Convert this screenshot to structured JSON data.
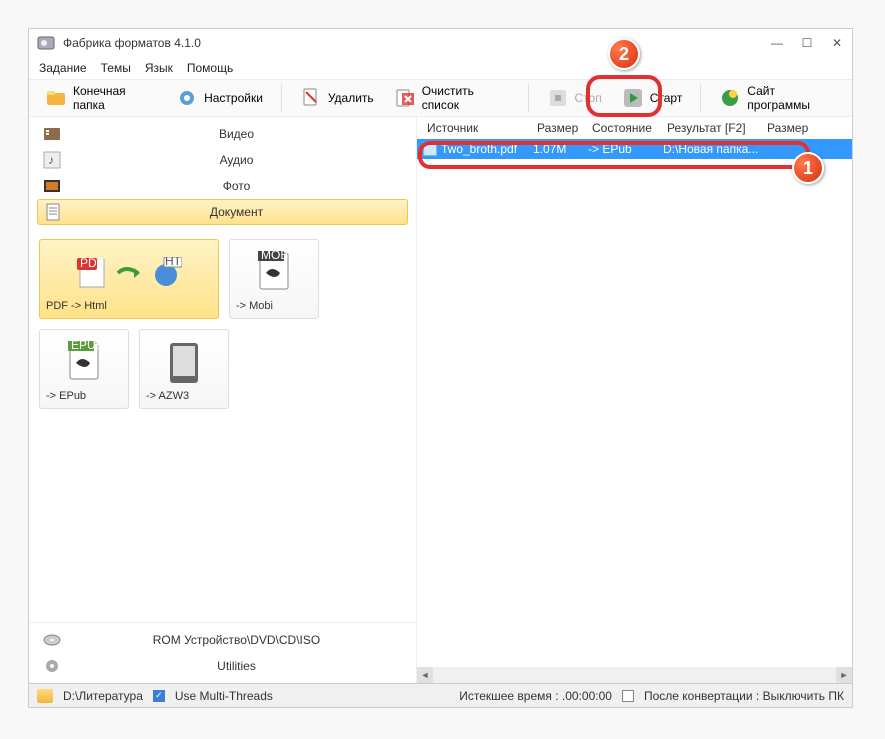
{
  "title": "Фабрика форматов 4.1.0",
  "menu": {
    "task": "Задание",
    "themes": "Темы",
    "lang": "Язык",
    "help": "Помощь"
  },
  "toolbar": {
    "dest_folder": "Конечная папка",
    "settings": "Настройки",
    "delete": "Удалить",
    "clear": "Очистить список",
    "stop": "Стоп",
    "start": "Старт",
    "site": "Сайт программы"
  },
  "categories": {
    "video": "Видео",
    "audio": "Аудио",
    "photo": "Фото",
    "document": "Документ",
    "rom": "ROM Устройство\\DVD\\CD\\ISO",
    "utilities": "Utilities"
  },
  "presets": {
    "pdf_html": "PDF -> Html",
    "mobi": "-> Mobi",
    "epub": "-> EPub",
    "azw3": "-> AZW3"
  },
  "columns": {
    "source": "Источник",
    "size": "Размер",
    "state": "Состояние",
    "result": "Результат [F2]",
    "size2": "Размер"
  },
  "file_row": {
    "name": "Two_broth.pdf",
    "size": "1.07M",
    "state": "-> EPub",
    "result": "D:\\Новая папка..."
  },
  "statusbar": {
    "path": "D:\\Литература",
    "multithreads": "Use Multi-Threads",
    "elapsed": "Истекшее время : .00:00:00",
    "after": "После конвертации : Выключить ПК"
  },
  "callouts": {
    "c1": "1",
    "c2": "2"
  }
}
